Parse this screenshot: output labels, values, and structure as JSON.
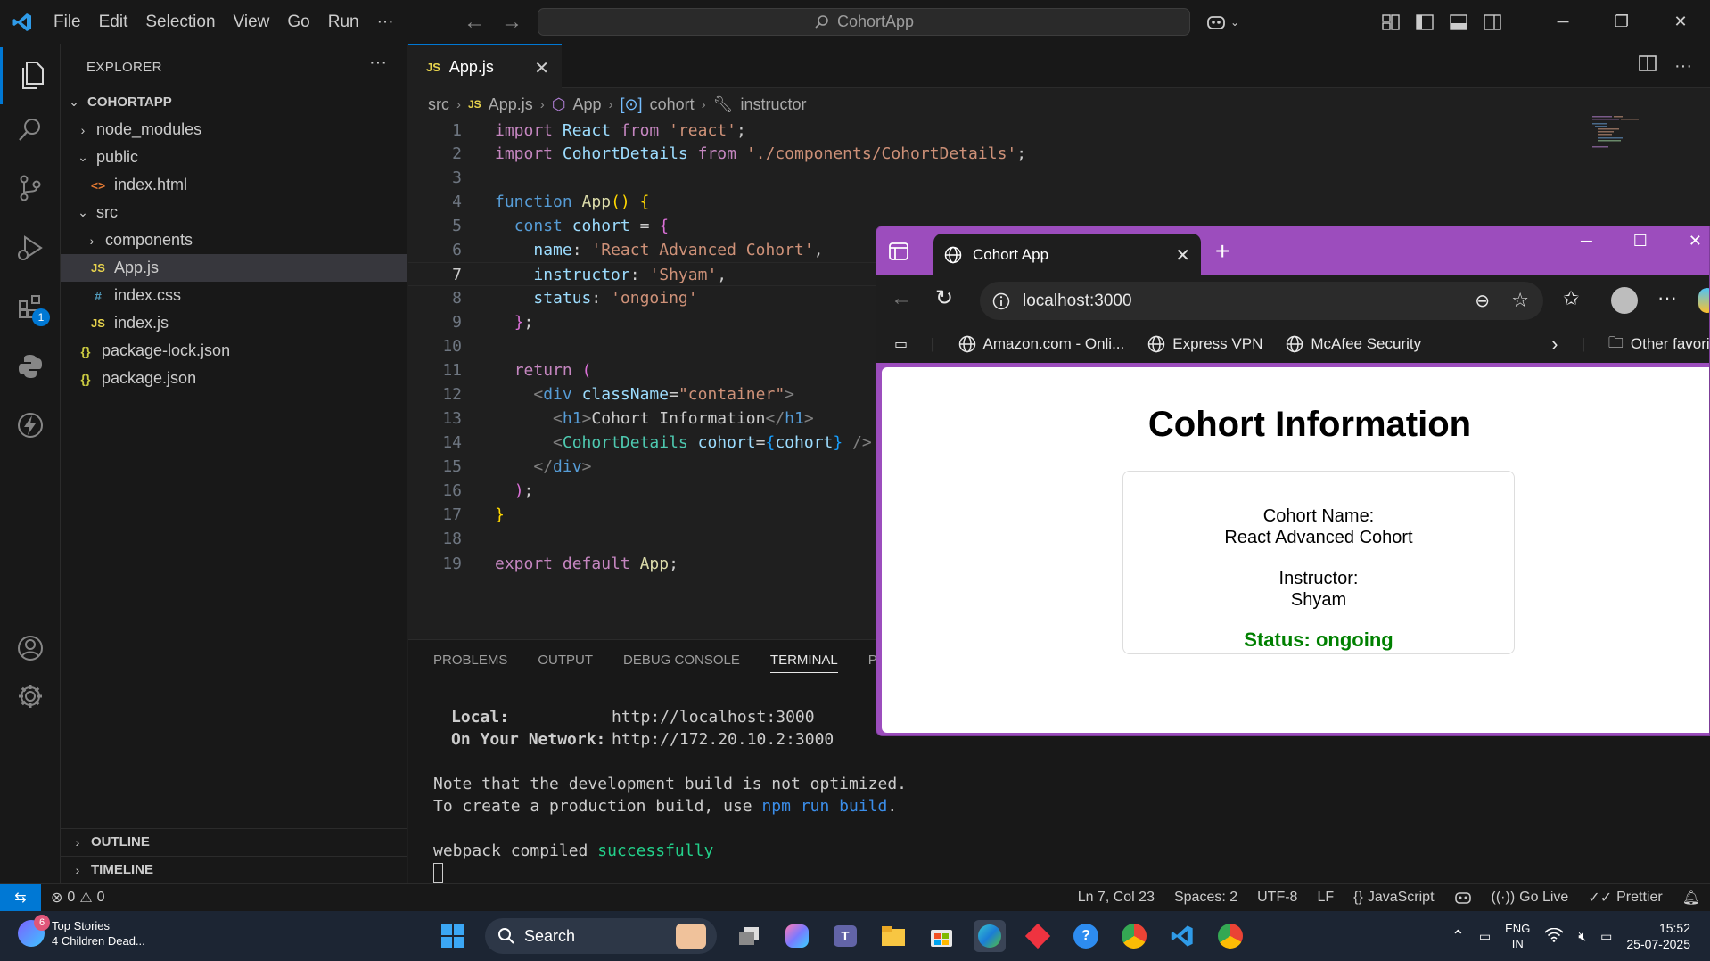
{
  "titlebar": {
    "menu": [
      "File",
      "Edit",
      "Selection",
      "View",
      "Go",
      "Run",
      "···"
    ],
    "command_center": "CohortApp"
  },
  "explorer": {
    "title": "EXPLORER",
    "more": "···",
    "project": "COHORTAPP",
    "items": [
      {
        "label": "node_modules",
        "type": "folder",
        "expanded": false
      },
      {
        "label": "public",
        "type": "folder",
        "expanded": true
      },
      {
        "label": "index.html",
        "type": "html"
      },
      {
        "label": "src",
        "type": "folder",
        "expanded": true
      },
      {
        "label": "components",
        "type": "folder",
        "expanded": false
      },
      {
        "label": "App.js",
        "type": "js",
        "selected": true
      },
      {
        "label": "index.css",
        "type": "css"
      },
      {
        "label": "index.js",
        "type": "js"
      },
      {
        "label": "package-lock.json",
        "type": "json"
      },
      {
        "label": "package.json",
        "type": "json"
      }
    ],
    "outline": "OUTLINE",
    "timeline": "TIMELINE"
  },
  "activity_badge": "1",
  "editor": {
    "tab_label": "App.js",
    "tab_icon": "JS",
    "breadcrumb": [
      "src",
      "App.js",
      "App",
      "cohort",
      "instructor"
    ],
    "current_line": 7
  },
  "code_lines": [
    "1",
    "2",
    "3",
    "4",
    "5",
    "6",
    "7",
    "8",
    "9",
    "10",
    "11",
    "12",
    "13",
    "14",
    "15",
    "16",
    "17",
    "18",
    "19"
  ],
  "panel": {
    "tabs": [
      "PROBLEMS",
      "OUTPUT",
      "DEBUG CONSOLE",
      "TERMINAL",
      "POR"
    ],
    "active_tab": "TERMINAL",
    "local_label": "Local:",
    "local_url": "http://localhost:3000",
    "network_label": "On Your Network:",
    "network_url": "http://172.20.10.2:3000",
    "note1": "Note that the development build is not optimized.",
    "note2_pre": "To create a production build, use ",
    "note2_cmd": "npm run build",
    "note2_post": ".",
    "webpack_pre": "webpack compiled ",
    "webpack_status": "successfully"
  },
  "statusbar": {
    "errors": "0",
    "warnings": "0",
    "position": "Ln 7, Col 23",
    "spaces": "Spaces: 2",
    "encoding": "UTF-8",
    "eol": "LF",
    "language": "JavaScript",
    "golive": "Go Live",
    "prettier": "Prettier"
  },
  "browser": {
    "tab_title": "Cohort App",
    "url": "localhost:3000",
    "bookmarks": [
      "Amazon.com - Onli...",
      "Express VPN",
      "McAfee Security"
    ],
    "other_favorites": "Other favorit",
    "page": {
      "heading": "Cohort Information",
      "name_label": "Cohort Name:",
      "name_value": "React Advanced Cohort",
      "instructor_label": "Instructor:",
      "instructor_value": "Shyam",
      "status": "Status: ongoing"
    }
  },
  "taskbar": {
    "news_badge": "6",
    "news_title": "Top Stories",
    "news_sub": "4 Children Dead...",
    "search": "Search",
    "lang1": "ENG",
    "lang2": "IN",
    "time": "15:52",
    "date": "25-07-2025"
  },
  "colors": {
    "accent": "#0078d4",
    "browser_frame": "#9c4dbd",
    "status_green": "#008000"
  }
}
